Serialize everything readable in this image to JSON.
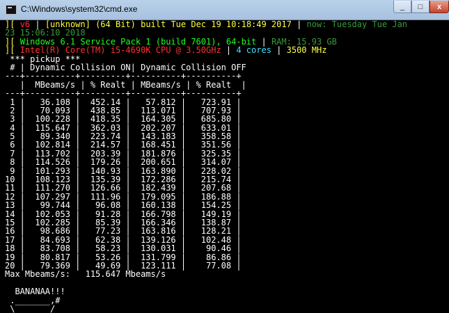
{
  "window": {
    "title": "C:\\Windows\\system32\\cmd.exe",
    "minimize_label": "_",
    "maximize_label": "□",
    "close_label": "x"
  },
  "colors": {
    "gray": "#c0c0c0",
    "red": "#ff3030",
    "yellow": "#ffff40",
    "green": "#20ff20",
    "dark_green": "#3a9a3a",
    "cyan": "#40e0ff",
    "white": "#ffffff"
  },
  "console_lines": [
    [
      [
        "yellow",
        "][ "
      ],
      [
        "red",
        "v6"
      ],
      [
        "white",
        " | "
      ],
      [
        "yellow",
        "[unknown] (64 Bit) built Tue Dec 19 10:18:49 2017"
      ],
      [
        "white",
        " | "
      ],
      [
        "dark_green",
        "now: Tuesday Tue Jan"
      ]
    ],
    [
      [
        "dark_green",
        "23 15:06:10 2018"
      ]
    ],
    [
      [
        "yellow",
        "][ "
      ],
      [
        "green",
        "Windows 6.1 Service Pack 1 (build 7601), 64-bit"
      ],
      [
        "white",
        " | "
      ],
      [
        "dark_green",
        "RAM: 15.93 GB"
      ]
    ],
    [
      [
        "yellow",
        "][ "
      ],
      [
        "red",
        "Intel(R) Core(TM) i5-4690K CPU @ 3.50GHz"
      ],
      [
        "white",
        " | "
      ],
      [
        "cyan",
        "4 cores"
      ],
      [
        "white",
        " | "
      ],
      [
        "yellow",
        "3500 MHz"
      ]
    ],
    [
      [
        "white",
        " *** pickup ***"
      ]
    ],
    [
      [
        "white",
        " # | Dynamic Collision ON| Dynamic Collision OFF"
      ]
    ],
    [
      [
        "white",
        "---+----------+---------+----------+----------+"
      ]
    ],
    [
      [
        "white",
        "   |  MBeams/s | % Realt | MBeams/s | % Realt  |"
      ]
    ],
    [
      [
        "white",
        "---+----------+---------+----------+----------+"
      ]
    ],
    [
      [
        "white",
        " 1 |   36.108 |  452.14 |   57.812 |   723.91 |"
      ]
    ],
    [
      [
        "white",
        " 2 |   70.093 |  438.85 |  113.071 |   707.93 |"
      ]
    ],
    [
      [
        "white",
        " 3 |  100.228 |  418.35 |  164.305 |   685.80 |"
      ]
    ],
    [
      [
        "white",
        " 4 |  115.647 |  362.03 |  202.207 |   633.01 |"
      ]
    ],
    [
      [
        "white",
        " 5 |   89.340 |  223.74 |  143.183 |   358.58 |"
      ]
    ],
    [
      [
        "white",
        " 6 |  102.814 |  214.57 |  168.451 |   351.56 |"
      ]
    ],
    [
      [
        "white",
        " 7 |  113.702 |  203.39 |  181.876 |   325.35 |"
      ]
    ],
    [
      [
        "white",
        " 8 |  114.526 |  179.26 |  200.651 |   314.07 |"
      ]
    ],
    [
      [
        "white",
        " 9 |  101.293 |  140.93 |  163.890 |   228.02 |"
      ]
    ],
    [
      [
        "white",
        "10 |  108.123 |  135.39 |  172.286 |   215.74 |"
      ]
    ],
    [
      [
        "white",
        "11 |  111.270 |  126.66 |  182.439 |   207.68 |"
      ]
    ],
    [
      [
        "white",
        "12 |  107.297 |  111.96 |  179.095 |   186.88 |"
      ]
    ],
    [
      [
        "white",
        "13 |   99.744 |   96.08 |  160.138 |   154.25 |"
      ]
    ],
    [
      [
        "white",
        "14 |  102.053 |   91.28 |  166.798 |   149.19 |"
      ]
    ],
    [
      [
        "white",
        "15 |  102.285 |   85.39 |  166.346 |   138.87 |"
      ]
    ],
    [
      [
        "white",
        "16 |   98.686 |   77.23 |  163.816 |   128.21 |"
      ]
    ],
    [
      [
        "white",
        "17 |   84.693 |   62.38 |  139.126 |   102.48 |"
      ]
    ],
    [
      [
        "white",
        "18 |   83.708 |   58.23 |  130.031 |    90.46 |"
      ]
    ],
    [
      [
        "white",
        "19 |   80.817 |   53.26 |  131.799 |    86.86 |"
      ]
    ],
    [
      [
        "white",
        "20 |   79.369 |   49.69 |  123.111 |    77.08 |"
      ]
    ],
    [
      [
        "white",
        "Max Mbeams/s:   115.647 Mbeams/s"
      ]
    ],
    [
      [
        "white",
        " "
      ]
    ],
    [
      [
        "white",
        "  BANANAA!!!"
      ]
    ],
    [
      [
        "white",
        " ._______,#"
      ]
    ],
    [
      [
        "white",
        " \\_______/"
      ]
    ],
    [
      [
        "white",
        "  `-----'"
      ]
    ]
  ]
}
